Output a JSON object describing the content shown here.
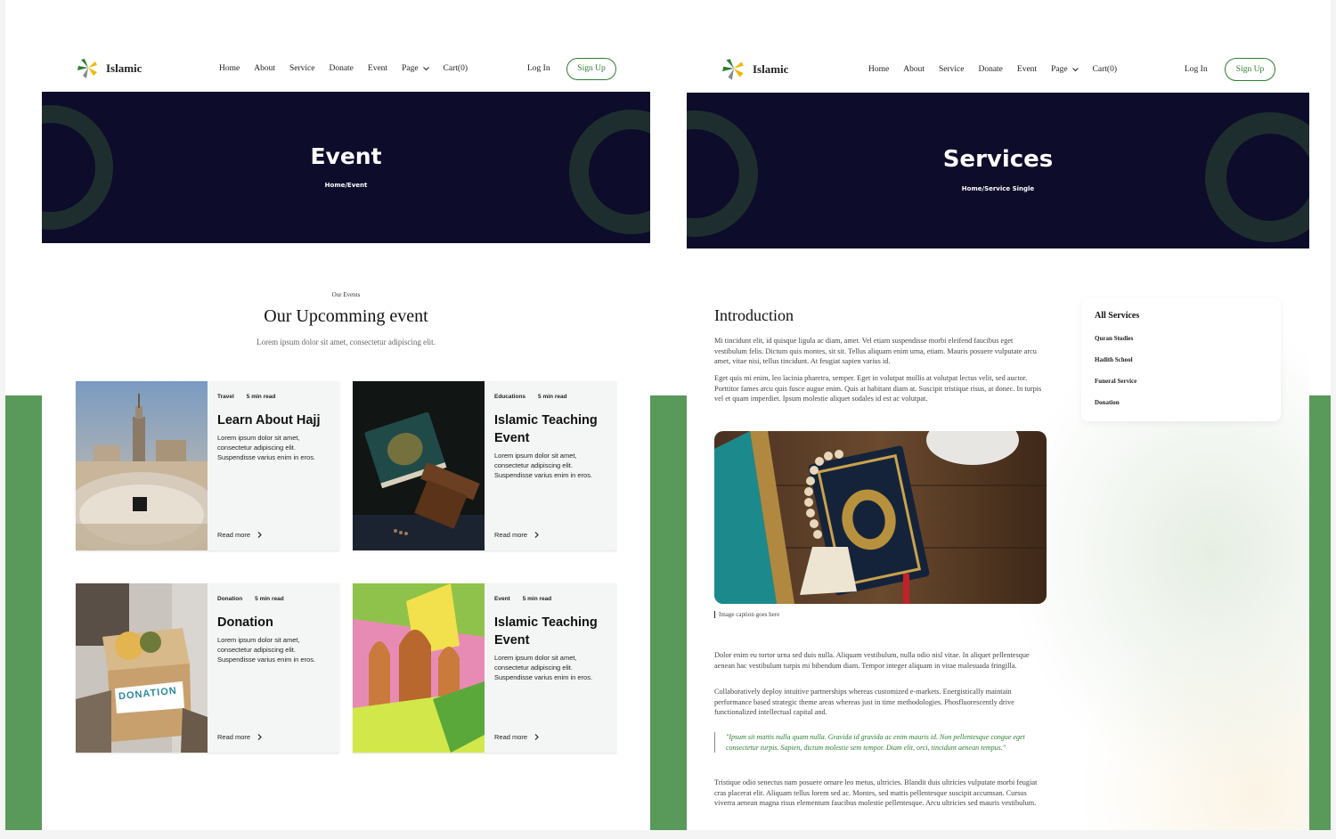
{
  "brand": {
    "name": "Islamic",
    "green": "#599a5b",
    "dark": "#0d0c2a",
    "accent": "#2e7d32"
  },
  "nav": {
    "items": [
      "Home",
      "About",
      "Service",
      "Donate",
      "Event",
      "Page",
      "Cart(0)"
    ],
    "login": "Log In",
    "signup": "Sign Up"
  },
  "event_page": {
    "hero_title": "Event",
    "breadcrumb": "Home/Event",
    "eyebrow": "Our Events",
    "title": "Our Upcomming event",
    "subtitle": "Lorem ipsum dolor sit amet, consectetur adipiscing elit.",
    "cards": [
      {
        "category": "Travel",
        "read_time": "5 min read",
        "title": "Learn About Hajj",
        "description": "Lorem ipsum dolor sit amet, consectetur adipiscing elit. Suspendisse varius enim in eros.",
        "link": "Read more"
      },
      {
        "category": "Educations",
        "read_time": "5 min read",
        "title": "Islamic Teaching Event",
        "description": "Lorem ipsum dolor sit amet, consectetur adipiscing elit. Suspendisse varius enim in eros.",
        "link": "Read more"
      },
      {
        "category": "Donation",
        "read_time": "5 min read",
        "title": "Donation",
        "description": "Lorem ipsum dolor sit amet, consectetur adipiscing elit. Suspendisse varius enim in eros.",
        "link": "Read more"
      },
      {
        "category": "Event",
        "read_time": "5 min read",
        "title": "Islamic Teaching Event",
        "description": "Lorem ipsum dolor sit amet, consectetur adipiscing elit. Suspendisse varius enim in eros.",
        "link": "Read more"
      }
    ],
    "donation_box_text": "DONATION"
  },
  "service_page": {
    "hero_title": "Services",
    "breadcrumb": "Home/Service Single",
    "intro_title": "Introduction",
    "intro_p1": "Mi tincidunt elit, id quisque ligula ac diam, amet. Vel etiam suspendisse morbi eleifend faucibus eget vestibulum felis. Dictum quis montes, sit sit. Tellus aliquam enim urna, etiam. Mauris posuere vulputate arcu amet, vitae nisi, tellus tincidunt. At feugiat sapien varius id.",
    "intro_p2": "Eget quis mi enim, leo lacinia pharetra, semper. Eget in volutpat mollis at volutpat lectus velit, sed auctor. Porttitor fames arcu quis fusce augue enim. Quis at habitant diam at. Suscipit tristique risus, at donec. In turpis vel et quam imperdiet. Ipsum molestie aliquet sodales id est ac volutpat.",
    "caption": "Image caption goes here",
    "body_p1": "Dolor enim eu tortor urna sed duis nulla. Aliquam vestibulum, nulla odio nisl vitae. In aliquet pellentesque aenean hac vestibulum turpis mi bibendum diam. Tempor integer aliquam in vitae malesuada fringilla.",
    "body_p2": "Collaboratively deploy intuitive partnerships whereas customized e-markets. Energistically maintain performance based strategic theme areas whereas just in time methodologies. Phosfluorescently drive functionalized intellectual capital and.",
    "quote": "\"Ipsum sit mattis nulla quam nulla. Gravida id gravida ac enim mauris id. Non pellentesque congue eget consectetur turpis. Sapien, dictum molestie sem tempor. Diam elit, orci, tincidunt aenean tempus.\"",
    "body_p3": "Tristique odio senectus nam posuere ornare leo metus, ultricies. Blandit duis ultricies vulputate morbi feugiat cras placerat elit. Aliquam tellus lorem sed ac. Montes, sed mattis pellentesque suscipit accumsan. Cursus viverra aenean magna risus elementum faucibus molestie pellentesque. Arcu ultricies sed mauris vestibulum.",
    "sidebar_title": "All Services",
    "sidebar_items": [
      "Quran Studies",
      "Hadith School",
      "Funeral Service",
      "Donation"
    ]
  }
}
